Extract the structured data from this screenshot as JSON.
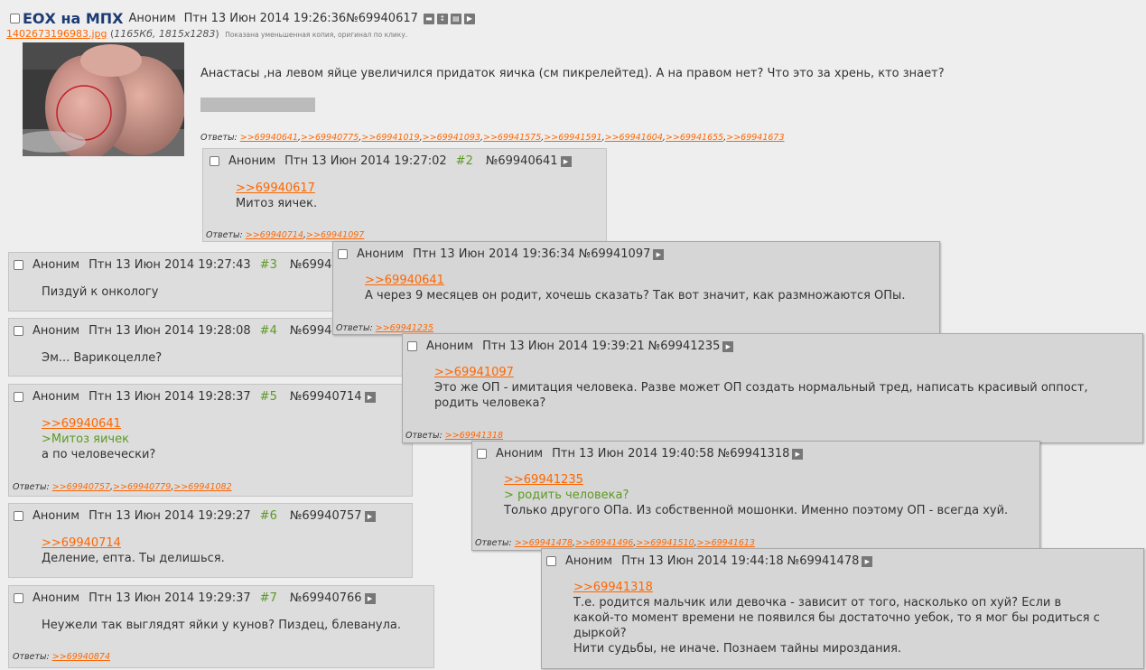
{
  "op": {
    "title": "ЕОХ на МПХ",
    "author": "Аноним",
    "date": "Птн 13 Июн 2014 19:26:36",
    "number": "№69940617",
    "file_name": "1402673196983.jpg",
    "file_meta": "1165Кб, 1815x1283",
    "file_note": "Показана уменьшенная копия, оригинал по клику.",
    "text": "Анастасы ,на левом яйце увеличился придаток яичка (см пикрелейтед). А на правом нет? Что это за хрень, кто знает?",
    "replies_label": "Ответы:",
    "replies": [
      ">>69940641",
      ">>69940775",
      ">>69941019",
      ">>69941093",
      ">>69941575",
      ">>69941591",
      ">>69941604",
      ">>69941655",
      ">>69941673"
    ]
  },
  "posts": {
    "p2": {
      "author": "Аноним",
      "date": "Птн 13 Июн 2014 19:27:02",
      "ord": "#2",
      "number": "№69940641",
      "ref": ">>69940617",
      "text": "Митоз яичек.",
      "replies": [
        ">>69940714",
        ">>69941097"
      ]
    },
    "p3": {
      "author": "Аноним",
      "date": "Птн 13 Июн 2014 19:27:43",
      "ord": "#3",
      "number": "№69940",
      "text": "Пиздуй к онкологу"
    },
    "p4": {
      "author": "Аноним",
      "date": "Птн 13 Июн 2014 19:28:08",
      "ord": "#4",
      "number": "№69940",
      "text": "Эм... Варикоцелле?"
    },
    "p5": {
      "author": "Аноним",
      "date": "Птн 13 Июн 2014 19:28:37",
      "ord": "#5",
      "number": "№69940714",
      "ref": ">>69940641",
      "quote": ">Митоз яичек",
      "text": "а по человечески?",
      "replies": [
        ">>69940757",
        ">>69940779",
        ">>69941082"
      ]
    },
    "p6": {
      "author": "Аноним",
      "date": "Птн 13 Июн 2014 19:29:27",
      "ord": "#6",
      "number": "№69940757",
      "ref": ">>69940714",
      "text": "Деление, епта. Ты делишься."
    },
    "p7": {
      "author": "Аноним",
      "date": "Птн 13 Июн 2014 19:29:37",
      "ord": "#7",
      "number": "№69940766",
      "text": "Неужели так выглядят яйки у кунов? Пиздец, блеванула.",
      "replies": [
        ">>69940874"
      ]
    },
    "pa": {
      "author": "Аноним",
      "date": "Птн 13 Июн 2014 19:36:34",
      "number": "№69941097",
      "ref": ">>69940641",
      "text": "А через 9 месяцев он родит, хочешь сказать? Так вот значит, как размножаются ОПы.",
      "replies": [
        ">>69941235"
      ]
    },
    "pb": {
      "author": "Аноним",
      "date": "Птн 13 Июн 2014 19:39:21",
      "number": "№69941235",
      "ref": ">>69941097",
      "line1": "Это же ОП - имитация человека. Разве может ОП создать нормальный тред, написать красивый оппост,",
      "line2": "родить человека?",
      "replies": [
        ">>69941318"
      ]
    },
    "pc": {
      "author": "Аноним",
      "date": "Птн 13 Июн 2014 19:40:58",
      "number": "№69941318",
      "ref": ">>69941235",
      "quote": "> родить человека?",
      "text": "Только другого ОПа. Из собственной мошонки. Именно поэтому ОП - всегда хуй.",
      "replies": [
        ">>69941478",
        ">>69941496",
        ">>69941510",
        ">>69941613"
      ]
    },
    "pd": {
      "author": "Аноним",
      "date": "Птн 13 Июн 2014 19:44:18",
      "number": "№69941478",
      "ref": ">>69941318",
      "line1": "Т.е. родится мальчик или девочка - зависит от того, насколько оп хуй? Если в",
      "line2": "какой-то момент времени не появился бы достаточно уебок, то я мог бы родиться с",
      "line3": "дыркой?",
      "line4": "Нити судьбы, не иначе. Познаем тайны мироздания."
    }
  },
  "labels": {
    "replies": "Ответы:"
  },
  "colors": {
    "link": "#ff6600",
    "quote": "#5c9a22",
    "title": "#1c3b72",
    "post_bg": "#dddddd",
    "page_bg": "#eeeeee"
  },
  "icons": [
    "minimize-icon",
    "expand-icon",
    "hide-icon",
    "play-icon"
  ]
}
